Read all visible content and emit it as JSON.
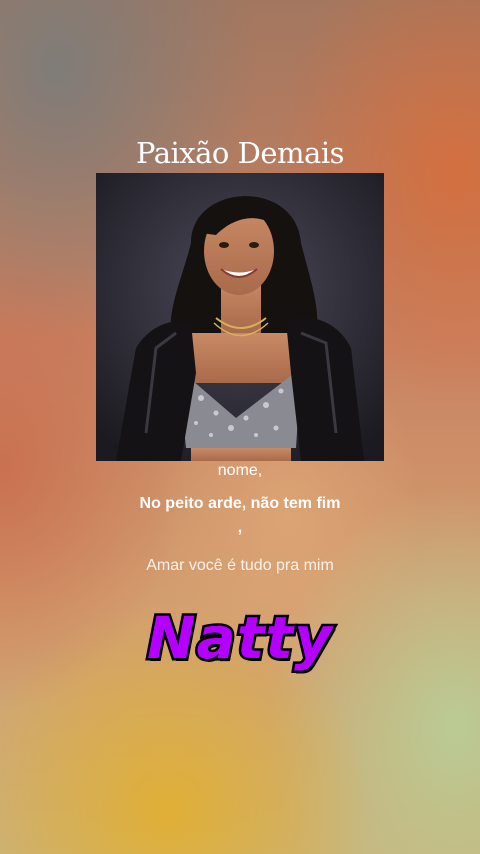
{
  "song": {
    "title": "Paixão Demais"
  },
  "cover": {
    "image_icon": "singer-portrait-icon"
  },
  "lyrics": {
    "previous": "nome,",
    "current": "No peito arde, não tem fim",
    "current_tail": ",",
    "next": "Amar você é tudo pra mim"
  },
  "watermark": {
    "text": "Natty",
    "color": "#b400ff"
  }
}
